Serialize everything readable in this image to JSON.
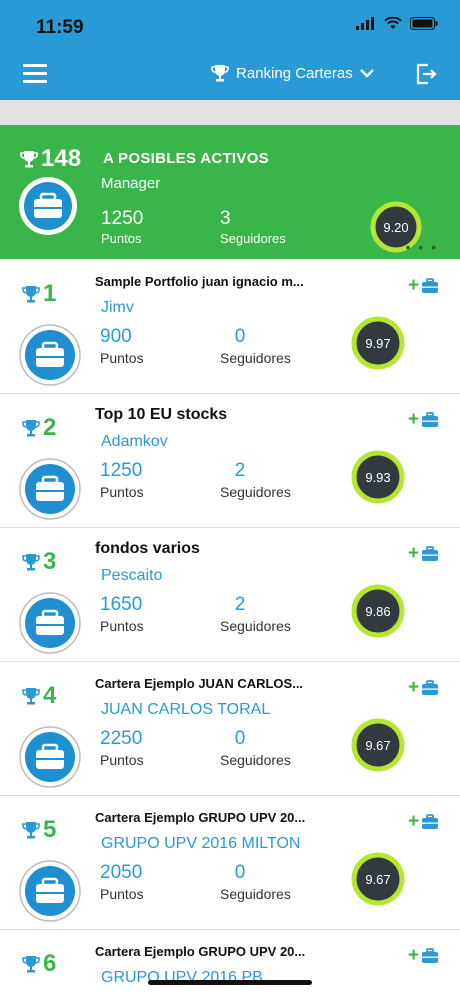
{
  "status_bar": {
    "time": "11:59"
  },
  "nav": {
    "title": "Ranking Carteras"
  },
  "header": {
    "rank": "148",
    "title": "A POSIBLES ACTIVOS",
    "owner": "Manager",
    "points": "1250",
    "points_label": "Puntos",
    "followers": "3",
    "followers_label": "Seguidores",
    "score": "9.20",
    "more": "• • •"
  },
  "rows": [
    {
      "rank": "1",
      "title": "Sample Portfolio juan ignacio m...",
      "owner": "Jimv",
      "points": "900",
      "points_label": "Puntos",
      "followers": "0",
      "followers_label": "Seguidores",
      "score": "9.97"
    },
    {
      "rank": "2",
      "title": "Top 10 EU stocks",
      "owner": "Adamkov",
      "points": "1250",
      "points_label": "Puntos",
      "followers": "2",
      "followers_label": "Seguidores",
      "score": "9.93"
    },
    {
      "rank": "3",
      "title": "fondos varios",
      "owner": "Pescaito",
      "points": "1650",
      "points_label": "Puntos",
      "followers": "2",
      "followers_label": "Seguidores",
      "score": "9.86"
    },
    {
      "rank": "4",
      "title": "Cartera Ejemplo JUAN CARLOS...",
      "owner": "JUAN CARLOS TORAL",
      "points": "2250",
      "points_label": "Puntos",
      "followers": "0",
      "followers_label": "Seguidores",
      "score": "9.67"
    },
    {
      "rank": "5",
      "title": "Cartera Ejemplo GRUPO UPV 20...",
      "owner": "GRUPO UPV 2016 MILTON",
      "points": "2050",
      "points_label": "Puntos",
      "followers": "0",
      "followers_label": "Seguidores",
      "score": "9.67"
    },
    {
      "rank": "6",
      "title": "Cartera Ejemplo GRUPO UPV 20...",
      "owner": "GRUPO UPV 2016 PB"
    }
  ],
  "colors": {
    "primary_blue": "#2a9ad6",
    "green": "#3ab54a",
    "score_ring": "#b6e632",
    "score_bg": "#333a3f"
  }
}
